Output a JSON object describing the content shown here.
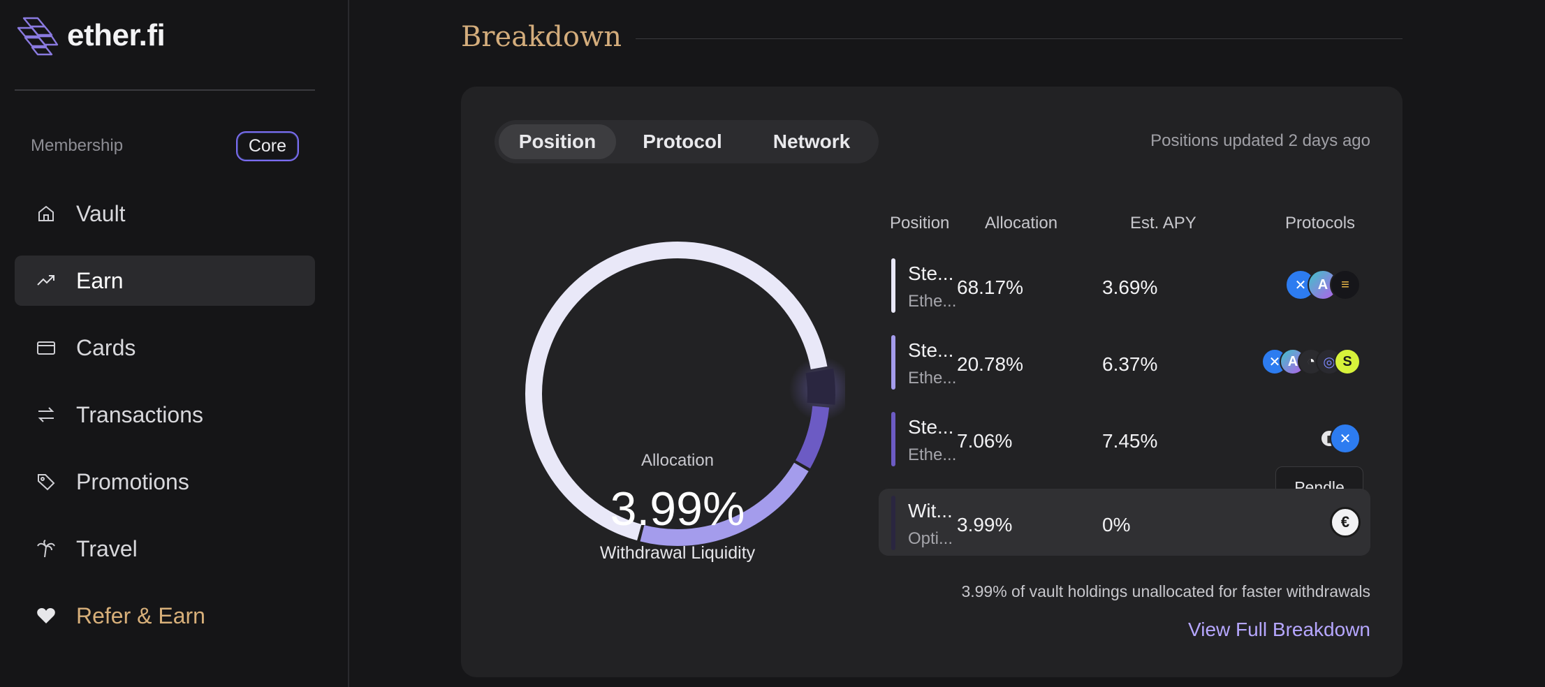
{
  "brand": {
    "name": "ether.fi"
  },
  "sidebar": {
    "membership_label": "Membership",
    "membership_tier": "Core",
    "items": [
      {
        "label": "Vault",
        "icon": "home-icon",
        "active": false
      },
      {
        "label": "Earn",
        "icon": "trending-up-icon",
        "active": true
      },
      {
        "label": "Cards",
        "icon": "credit-card-icon",
        "active": false
      },
      {
        "label": "Transactions",
        "icon": "arrows-exchange-icon",
        "active": false
      },
      {
        "label": "Promotions",
        "icon": "tag-icon",
        "active": false
      },
      {
        "label": "Travel",
        "icon": "palm-tree-icon",
        "active": false
      },
      {
        "label": "Refer & Earn",
        "icon": "heart-icon",
        "active": false
      }
    ]
  },
  "breakdown": {
    "title": "Breakdown",
    "tabs": [
      "Position",
      "Protocol",
      "Network"
    ],
    "active_tab": "Position",
    "updated_text": "Positions updated 2 days ago",
    "donut": {
      "label": "Allocation",
      "value": "3.99%",
      "sub": "Withdrawal Liquidity",
      "segments": [
        {
          "name": "Ste…",
          "percent": 68.17,
          "color": "#e9e8f8"
        },
        {
          "name": "Ste…",
          "percent": 20.78,
          "color": "#a49cec"
        },
        {
          "name": "Ste…",
          "percent": 7.06,
          "color": "#6c5bc4"
        },
        {
          "name": "Wit…",
          "percent": 3.99,
          "color": "#2a2640"
        }
      ]
    },
    "table": {
      "headers": {
        "position": "Position",
        "allocation": "Allocation",
        "apy": "Est. APY",
        "protocols": "Protocols"
      },
      "rows": [
        {
          "name": "Ste...",
          "sub": "Ethe...",
          "allocation": "68.17%",
          "apy": "3.69%",
          "bar_color": "#e9e8f8",
          "highlight": false
        },
        {
          "name": "Ste...",
          "sub": "Ethe...",
          "allocation": "20.78%",
          "apy": "6.37%",
          "bar_color": "#a49cec",
          "highlight": false
        },
        {
          "name": "Ste...",
          "sub": "Ethe...",
          "allocation": "7.06%",
          "apy": "7.45%",
          "bar_color": "#6c5bc4",
          "highlight": false
        },
        {
          "name": "Wit...",
          "sub": "Opti...",
          "allocation": "3.99%",
          "apy": "0%",
          "bar_color": "#2a2640",
          "highlight": true
        }
      ]
    },
    "tooltip": "Pendle",
    "footnote": "3.99% of vault holdings unallocated for faster withdrawals",
    "view_full": "View Full Breakdown"
  }
}
